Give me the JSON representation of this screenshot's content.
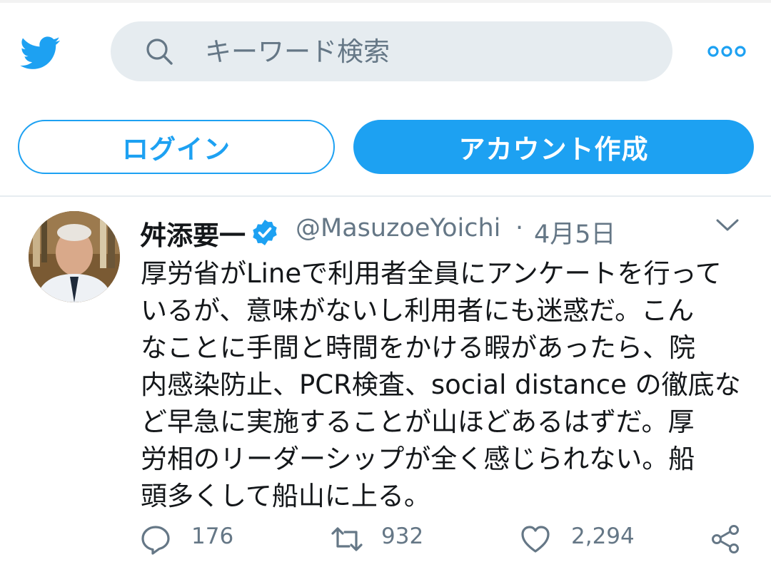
{
  "header": {
    "search_placeholder": "キーワード検索",
    "logo_icon": "twitter-bird-icon",
    "more_icon": "more-dots-icon"
  },
  "auth": {
    "login_label": "ログイン",
    "signup_label": "アカウント作成"
  },
  "tweet": {
    "author_name": "舛添要一",
    "handle": "@MasuzoeYoichi",
    "separator": "·",
    "date": "4月5日",
    "text": "厚労省がLineで利用者全員にアンケートを行って\nいるが、意味がないし利用者にも迷惑だ。こん\nなことに手間と時間をかける暇があったら、院\n内感染防止、PCR検査、social distance の徹底な\nど早急に実施することが山ほどあるはずだ。厚\n労相のリーダーシップが全く感じられない。船\n頭多くして船山に上る。",
    "replies": "176",
    "retweets": "932",
    "likes": "2,294"
  },
  "colors": {
    "brand_blue": "#1da1f2",
    "search_bg": "#e6ecf0",
    "muted_text": "#657786",
    "text": "#14171a"
  }
}
